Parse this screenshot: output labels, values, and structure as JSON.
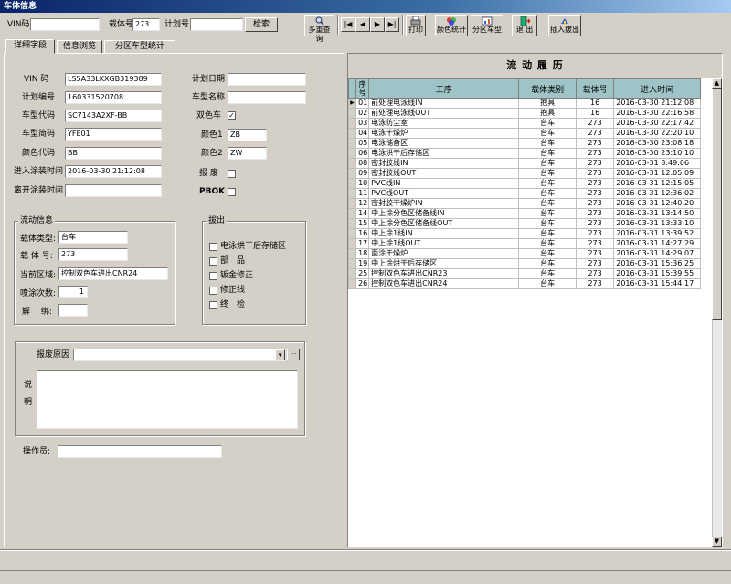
{
  "window": {
    "title": "车体信息"
  },
  "toolbar": {
    "vin_label": "VIN码",
    "vin_value": "",
    "carrier_label": "载体号",
    "carrier_value": "273",
    "plan_label": "计划号",
    "plan_value": "",
    "search_label": "检索",
    "multi_query_label": "多重查询",
    "nav_first": "|◀",
    "nav_prev": "◀",
    "nav_next": "▶",
    "nav_last": "▶|",
    "print_label": "打印",
    "color_stats_label": "颜色统计",
    "zone_car_label": "分区车型",
    "exit_label": "退 出",
    "insert_pull_label": "插入拔出"
  },
  "tabs": [
    "详细字段",
    "信息浏览",
    "分区车型统计"
  ],
  "details": {
    "vin_label": "VIN 码",
    "vin_value": "LS5A33LKXGB319389",
    "plan_no_label": "计划编号",
    "plan_no_value": "160331520708",
    "model_code_label": "车型代码",
    "model_code_value": "SC7143A2XF-BB",
    "model_short_label": "车型简码",
    "model_short_value": "YFE01",
    "color_code_label": "颜色代码",
    "color_code_value": "BB",
    "enter_time_label": "进入涂装时间",
    "enter_time_value": "2016-03-30 21:12:08",
    "leave_time_label": "离开涂装时间",
    "leave_time_value": "",
    "plan_date_label": "计划日期",
    "plan_date_value": "",
    "model_name_label": "车型名称",
    "model_name_value": "",
    "two_tone_label": "双色车",
    "two_tone_checked": "✓",
    "color1_label": "颜色1",
    "color1_value": "ZB",
    "color2_label": "颜色2",
    "color2_value": "ZW",
    "scrap_label": "报 废",
    "pbok_label": "PBOK"
  },
  "flow": {
    "title": "流动信息",
    "carrier_type_label": "载体类型:",
    "carrier_type_value": "台车",
    "carrier_no_label": "载 体 号:",
    "carrier_no_value": "273",
    "area_label": "当前区域:",
    "area_value": "控制双色车进出CNR24",
    "spray_count_label": "喷涂次数:",
    "spray_count_value": "1",
    "unbind_label": "解　 绑:",
    "unbind_value": ""
  },
  "pullout": {
    "title": "拔出",
    "options": [
      "电泳烘干后存储区",
      "部　品",
      "钣金修正",
      "修正线",
      "终　检"
    ]
  },
  "scrap": {
    "reason_label": "报废原因",
    "reason_value": "",
    "ellipsis": "···",
    "desc_label_1": "说",
    "desc_label_2": "明",
    "desc_value": ""
  },
  "operator": {
    "label": "操作员:",
    "value": ""
  },
  "history": {
    "title": "流 动 履 历",
    "columns": [
      "序号",
      "工序",
      "载体类别",
      "载体号",
      "进入时间"
    ],
    "rows": [
      [
        "01",
        "前处理电泳线IN",
        "抱具",
        "16",
        "2016-03-30 21:12:08"
      ],
      [
        "02",
        "前处理电泳线OUT",
        "抱具",
        "16",
        "2016-03-30 22:16:58"
      ],
      [
        "03",
        "电泳防尘室",
        "台车",
        "273",
        "2016-03-30 22:17:42"
      ],
      [
        "04",
        "电泳干燥炉",
        "台车",
        "273",
        "2016-03-30 22:20:10"
      ],
      [
        "05",
        "电泳储备区",
        "台车",
        "273",
        "2016-03-30 23:08:18"
      ],
      [
        "06",
        "电泳烘干后存储区",
        "台车",
        "273",
        "2016-03-30 23:10:10"
      ],
      [
        "08",
        "密封胶线IN",
        "台车",
        "273",
        "2016-03-31 8:49:06"
      ],
      [
        "09",
        "密封胶线OUT",
        "台车",
        "273",
        "2016-03-31 12:05:09"
      ],
      [
        "10",
        "PVC线IN",
        "台车",
        "273",
        "2016-03-31 12:15:05"
      ],
      [
        "11",
        "PVC线OUT",
        "台车",
        "273",
        "2016-03-31 12:36:02"
      ],
      [
        "12",
        "密封胶干燥炉IN",
        "台车",
        "273",
        "2016-03-31 12:40:20"
      ],
      [
        "14",
        "中上涂分色区储备线IN",
        "台车",
        "273",
        "2016-03-31 13:14:50"
      ],
      [
        "15",
        "中上涂分色区储备线OUT",
        "台车",
        "273",
        "2016-03-31 13:33:10"
      ],
      [
        "16",
        "中上涂1线IN",
        "台车",
        "273",
        "2016-03-31 13:39:52"
      ],
      [
        "17",
        "中上涂1线OUT",
        "台车",
        "273",
        "2016-03-31 14:27:29"
      ],
      [
        "18",
        "面涂干燥炉",
        "台车",
        "273",
        "2016-03-31 14:29:07"
      ],
      [
        "19",
        "中上涂烘干后存储区",
        "台车",
        "273",
        "2016-03-31 15:36:25"
      ],
      [
        "25",
        "控制双色车进出CNR23",
        "台车",
        "273",
        "2016-03-31 15:39:55"
      ],
      [
        "26",
        "控制双色车进出CNR24",
        "台车",
        "273",
        "2016-03-31 15:44:17"
      ]
    ]
  },
  "colors": {
    "title_bar": "#0a246a",
    "header_bg": "#9ec4c8",
    "selected_row": "#ffffff"
  }
}
